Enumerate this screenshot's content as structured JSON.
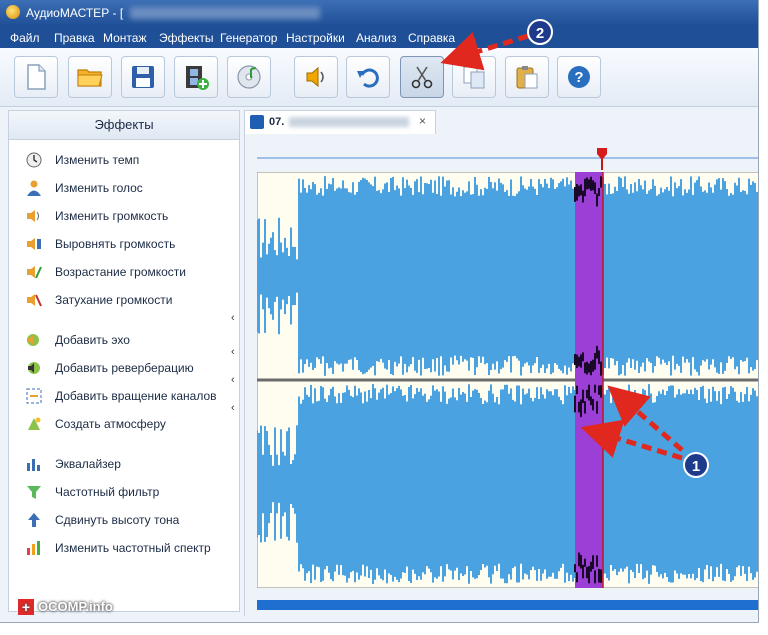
{
  "window": {
    "title": "АудиоМАСТЕР - ["
  },
  "menu": [
    "Файл",
    "Правка",
    "Монтаж",
    "Эффекты",
    "Генератор",
    "Настройки",
    "Анализ",
    "Справка"
  ],
  "toolbar": {
    "buttons": [
      {
        "name": "new-file",
        "icon": "document-icon"
      },
      {
        "name": "open",
        "icon": "folder-icon"
      },
      {
        "name": "save",
        "icon": "floppy-icon"
      },
      {
        "name": "video",
        "icon": "film-icon"
      },
      {
        "name": "cd",
        "icon": "cd-icon"
      },
      {
        "name": "speaker",
        "icon": "speaker-icon"
      },
      {
        "name": "undo",
        "icon": "undo-icon"
      },
      {
        "name": "cut",
        "icon": "scissors-icon"
      },
      {
        "name": "copy",
        "icon": "copy-icon"
      },
      {
        "name": "paste",
        "icon": "paste-icon"
      },
      {
        "name": "help",
        "icon": "help-icon"
      }
    ]
  },
  "sidebar": {
    "header": "Эффекты",
    "items": [
      {
        "label": "Изменить темп",
        "icon": "clock-icon"
      },
      {
        "label": "Изменить голос",
        "icon": "person-icon"
      },
      {
        "label": "Изменить громкость",
        "icon": "volume-icon"
      },
      {
        "label": "Выровнять громкость",
        "icon": "level-icon"
      },
      {
        "label": "Возрастание громкости",
        "icon": "fade-in-icon"
      },
      {
        "label": "Затухание громкости",
        "icon": "fade-out-icon"
      },
      {
        "label": "Добавить эхо",
        "icon": "echo-icon"
      },
      {
        "label": "Добавить реверберацию",
        "icon": "reverb-icon"
      },
      {
        "label": "Добавить вращение каналов",
        "icon": "rotate-channels-icon"
      },
      {
        "label": "Создать атмосферу",
        "icon": "atmosphere-icon"
      },
      {
        "label": "Эквалайзер",
        "icon": "equalizer-icon"
      },
      {
        "label": "Частотный фильтр",
        "icon": "filter-icon"
      },
      {
        "label": "Сдвинуть высоту тона",
        "icon": "pitch-icon"
      },
      {
        "label": "Изменить частотный спектр",
        "icon": "spectrum-icon"
      }
    ]
  },
  "tab": {
    "label": "07.",
    "close": "×"
  },
  "annotations": {
    "marker_1": "1",
    "marker_2": "2"
  },
  "watermark": {
    "plus": "+",
    "text": "OCOMP.info"
  },
  "colors": {
    "waveform": "#4aa3e0",
    "selection": "#9b3fd6",
    "arrow": "#e0281f",
    "badge": "#1e3a8a"
  }
}
